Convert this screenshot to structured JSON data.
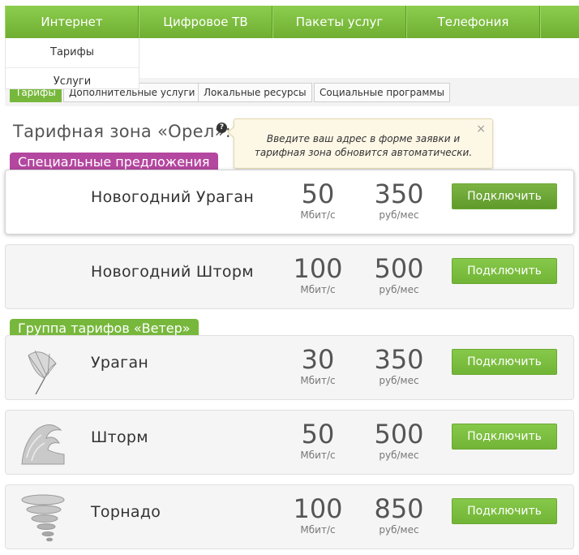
{
  "topnav": {
    "items": [
      {
        "label": "Интернет"
      },
      {
        "label": "Цифровое ТВ"
      },
      {
        "label": "Пакеты услуг"
      },
      {
        "label": "Телефония"
      },
      {
        "label": ""
      }
    ]
  },
  "dropdown": {
    "items": [
      {
        "label": "Тарифы"
      },
      {
        "label": "Услуги"
      }
    ]
  },
  "subtabs": [
    {
      "label": "Тарифы",
      "active": true
    },
    {
      "label": "Дополнительные услуги"
    },
    {
      "label": "Локальные ресурсы"
    },
    {
      "label": "Социальные программы"
    }
  ],
  "zone": {
    "title": "Тарифная зона «Орел»:",
    "help": "?"
  },
  "tooltip": {
    "line1": "Введите ваш адрес в форме заявки и",
    "line2": "тарифная зона обновится автоматически.",
    "close": "×"
  },
  "sections": {
    "special": "Специальные предложения",
    "wind": "Группа тарифов «Ветер»"
  },
  "tariffs": [
    {
      "name": "Новогодний Ураган",
      "speed": "50",
      "speed_unit": "Мбит/с",
      "price": "350",
      "price_unit": "руб/мес",
      "button": "Подключить",
      "icon": ""
    },
    {
      "name": "Новогодний Шторм",
      "speed": "100",
      "speed_unit": "Мбит/с",
      "price": "500",
      "price_unit": "руб/мес",
      "button": "Подключить",
      "icon": ""
    },
    {
      "name": "Ураган",
      "speed": "30",
      "speed_unit": "Мбит/с",
      "price": "350",
      "price_unit": "руб/мес",
      "button": "Подключить",
      "icon": "umbrella-icon"
    },
    {
      "name": "Шторм",
      "speed": "50",
      "speed_unit": "Мбит/с",
      "price": "500",
      "price_unit": "руб/мес",
      "button": "Подключить",
      "icon": "wave-icon"
    },
    {
      "name": "Торнадо",
      "speed": "100",
      "speed_unit": "Мбит/с",
      "price": "850",
      "price_unit": "руб/мес",
      "button": "Подключить",
      "icon": "tornado-icon"
    }
  ],
  "colors": {
    "accent_green": "#77b83c",
    "special_purple": "#b4479f",
    "tooltip_bg": "#fdf7e6"
  }
}
